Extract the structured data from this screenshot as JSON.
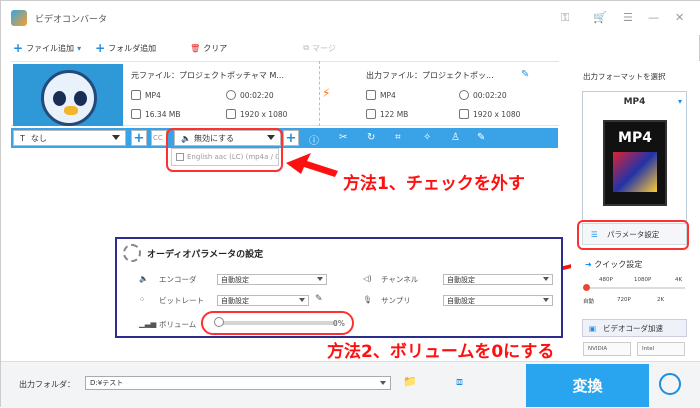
{
  "app": {
    "title": "ビデオコンバータ"
  },
  "toolbar": {
    "add_file": "ファイル追加",
    "add_folder": "フォルダ追加",
    "clear": "クリア",
    "merge": "マージ"
  },
  "task": {
    "source_label": "元ファイル：プロジェクトポッチャマ M...",
    "output_label": "出力ファイル：プロジェクトポッ...",
    "src_format": "MP4",
    "src_duration": "00:02:20",
    "src_size": "16.34 MB",
    "src_resolution": "1920 x 1080",
    "out_format": "MP4",
    "out_duration": "00:02:20",
    "out_size": "122 MB",
    "out_resolution": "1920 x 1080"
  },
  "editbar": {
    "subtitle": "なし",
    "audio": "無効にする",
    "cc": "CC"
  },
  "audio_popup": {
    "track": "English aac (LC) (mp4a / 0"
  },
  "callouts": {
    "method1": "方法1、チェックを外す",
    "method2": "方法2、ボリュームを0にする"
  },
  "audio_panel": {
    "title": "オーディオパラメータの設定",
    "encoder_label": "エンコーダ",
    "encoder_value": "自動設定",
    "bitrate_label": "ビットレート",
    "bitrate_value": "自動設定",
    "volume_label": "ボリューム",
    "volume_value": "0%",
    "volume_level": 0,
    "channel_label": "チャンネル",
    "channel_value": "自動設定",
    "samplerate_label": "サンプリ",
    "samplerate_value": "自動設定"
  },
  "right": {
    "format_select_title": "出力フォーマットを選択",
    "format": "MP4",
    "format_badge": "MP4",
    "param_btn": "パラメータ設定",
    "quick_label": "クイック設定",
    "ticks_top": [
      "480P",
      "1080P",
      "4K"
    ],
    "ticks_bottom": [
      "自動",
      "720P",
      "2K"
    ],
    "gpu_btn": "ビデオコーダ加速",
    "nvidia": "NVIDIA",
    "intel": "Intel"
  },
  "bottom": {
    "output_folder_label": "出力フォルダ：",
    "output_path": "D:¥テスト",
    "convert": "変換"
  },
  "colors": {
    "accent": "#29a4ef",
    "callout": "#ff1010"
  }
}
